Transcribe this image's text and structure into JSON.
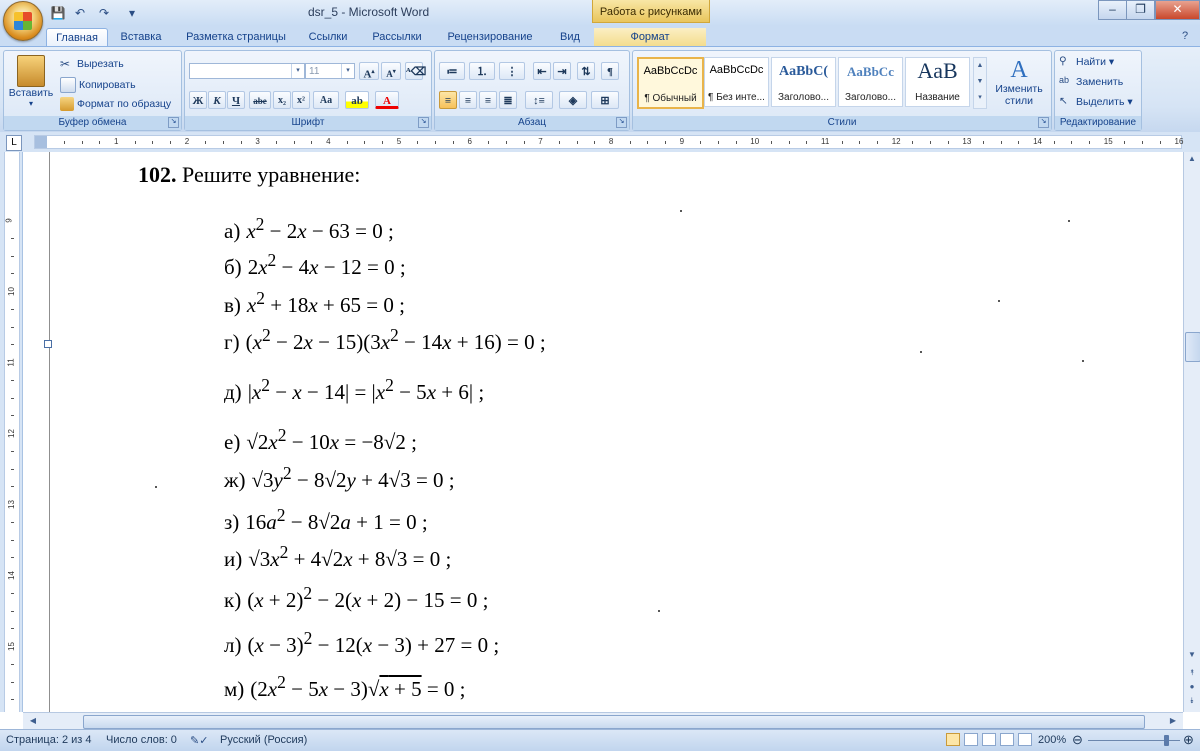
{
  "window": {
    "title": "dsr_5 - Microsoft Word",
    "context_tab_group": "Работа с рисунками"
  },
  "tabs": [
    "Главная",
    "Вставка",
    "Разметка страницы",
    "Ссылки",
    "Рассылки",
    "Рецензирование",
    "Вид",
    "Формат"
  ],
  "active_tab": "Главная",
  "ribbon": {
    "clipboard": {
      "paste": "Вставить",
      "cut": "Вырезать",
      "copy": "Копировать",
      "format_painter": "Формат по образцу",
      "label": "Буфер обмена"
    },
    "font": {
      "font_name": "",
      "font_size": "11",
      "bold": "Ж",
      "italic": "К",
      "underline": "Ч",
      "strike": "abe",
      "sub": "x₂",
      "sup": "x²",
      "case": "Aa",
      "label": "Шрифт"
    },
    "paragraph": {
      "label": "Абзац"
    },
    "styles": {
      "items": [
        {
          "sample": "AaBbCcDc",
          "name": "¶ Обычный"
        },
        {
          "sample": "AaBbCcDc",
          "name": "¶ Без инте..."
        },
        {
          "sample": "AaBbC(",
          "name": "Заголово..."
        },
        {
          "sample": "AaBbCc",
          "name": "Заголово..."
        },
        {
          "sample": "AaB",
          "name": "Название"
        }
      ],
      "change": "Изменить стили",
      "label": "Стили"
    },
    "editing": {
      "find": "Найти",
      "replace": "Заменить",
      "select": "Выделить",
      "label": "Редактирование"
    }
  },
  "ruler": {
    "h_numbers": [
      "1",
      "2",
      "3",
      "4",
      "5",
      "6",
      "7",
      "8",
      "9",
      "10",
      "11",
      "12",
      "13",
      "14",
      "15",
      "16"
    ],
    "v_numbers": [
      "9",
      "10",
      "11",
      "12",
      "13",
      "14",
      "15"
    ]
  },
  "document": {
    "title_number": "102.",
    "title_text": " Решите уравнение:",
    "equations": [
      {
        "label": "а)",
        "html": "<i>x</i><sup>2</sup> − 2<i>x</i> − 63 = 0 ;"
      },
      {
        "label": "б)",
        "html": "2<i>x</i><sup>2</sup> − 4<i>x</i> − 12 = 0 ;"
      },
      {
        "label": "в)",
        "html": "<i>x</i><sup>2</sup> + 18<i>x</i> + 65 = 0 ;"
      },
      {
        "label": "г)",
        "html": "(<i>x</i><sup>2</sup> − 2<i>x</i> − 15)(3<i>x</i><sup>2</sup> − 14<i>x</i> + 16) = 0 ;"
      },
      {
        "label": "д)",
        "html": "|<i>x</i><sup>2</sup> − <i>x</i> − 14| = |<i>x</i><sup>2</sup> − 5<i>x</i> + 6| ;"
      },
      {
        "label": "е)",
        "html": "√2<i>x</i><sup>2</sup> − 10<i>x</i> = −8√2 ;"
      },
      {
        "label": "ж)",
        "html": "√3<i>y</i><sup>2</sup> − 8√2<i>y</i> + 4√3 = 0 ;"
      },
      {
        "label": "з)",
        "html": "16<i>a</i><sup>2</sup> − 8√2<i>a</i> + 1 = 0 ;"
      },
      {
        "label": "и)",
        "html": "√3<i>x</i><sup>2</sup> + 4√2<i>x</i> + 8√3 = 0 ;"
      },
      {
        "label": "к)",
        "html": "(<i>x</i> + 2)<sup>2</sup> − 2(<i>x</i> + 2) − 15 = 0 ;"
      },
      {
        "label": "л)",
        "html": "(<i>x</i> − 3)<sup>2</sup> − 12(<i>x</i> − 3) + 27 = 0 ;"
      },
      {
        "label": "м)",
        "html": "(2<i>x</i><sup>2</sup> − 5<i>x</i> − 3)√<span style=\"text-decoration:overline\"><i>x</i> + 5</span> = 0 ;"
      }
    ]
  },
  "status": {
    "page": "Страница: 2 из 4",
    "words": "Число слов: 0",
    "language": "Русский (Россия)",
    "zoom": "200%"
  }
}
